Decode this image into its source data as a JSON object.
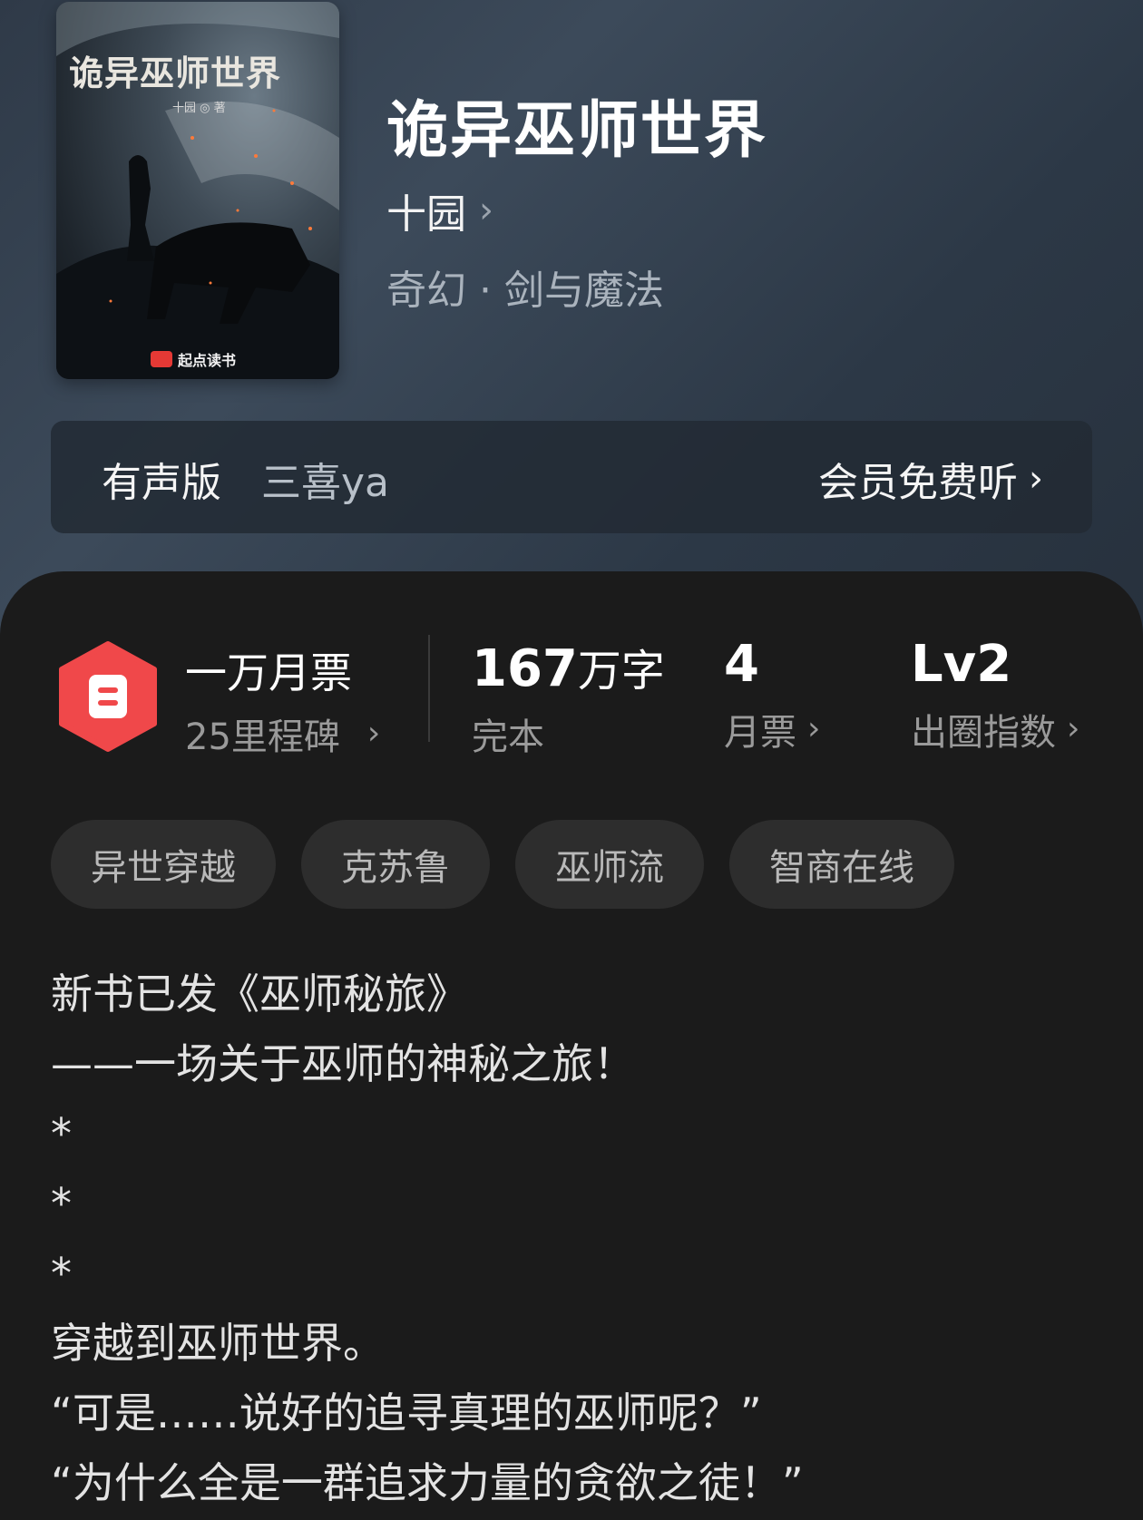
{
  "book": {
    "cover": {
      "title": "诡异巫师世界",
      "author": "十园 ◎ 著",
      "publisher": "起点读书"
    },
    "title": "诡异巫师世界",
    "author": "十园",
    "genre": "奇幻 · 剑与魔法"
  },
  "audio": {
    "label": "有声版",
    "narrator": "三喜ya",
    "cta": "会员免费听"
  },
  "stats": {
    "honor_title": "一万月票",
    "honor_sub": "25里程碑",
    "word_count_number": "167",
    "word_count_unit": "万字",
    "status": "完本",
    "monthly_tickets_value": "4",
    "monthly_tickets_label": "月票",
    "influence_value": "Lv2",
    "influence_label": "出圈指数"
  },
  "tags": [
    "异世穿越",
    "克苏鲁",
    "巫师流",
    "智商在线"
  ],
  "description": [
    "新书已发《巫师秘旅》",
    "——一场关于巫师的神秘之旅！",
    "*",
    "*",
    "*",
    "穿越到巫师世界。",
    "“可是……说好的追寻真理的巫师呢？”",
    "“为什么全是一群追求力量的贪欲之徒！”"
  ],
  "colors": {
    "badge": "#f0484a",
    "sheet": "#1b1b1b",
    "header": "#2f3a48"
  }
}
